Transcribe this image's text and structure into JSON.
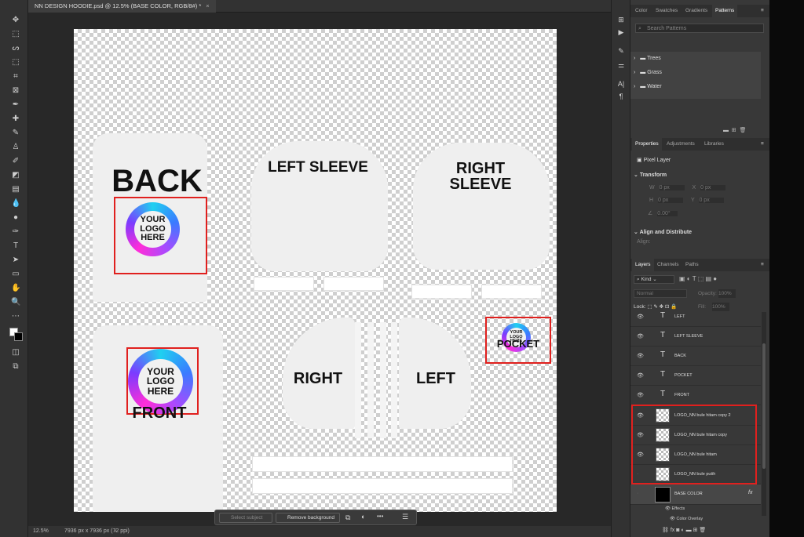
{
  "document": {
    "tab_title": "NN DESIGN HOODIE.psd @ 12.5% (BASE COLOR, RGB/8#) *",
    "tab_close": "×",
    "zoom": "12.5%",
    "dimensions": "7936 px x 7936 px (72 ppi)"
  },
  "artwork": {
    "back_label": "BACK",
    "left_sleeve": "LEFT SLEEVE",
    "right_sleeve": "RIGHT SLEEVE",
    "right_label": "RIGHT",
    "left_label": "LEFT",
    "pocket_label": "POCKET",
    "front_label": "FRONT",
    "logo_text": "YOUR LOGO HERE",
    "logo_text_small": "YOUR LOGO HERE"
  },
  "taskbar": {
    "select_subject": "Select subject",
    "remove_background": "Remove background",
    "more": "•••"
  },
  "patterns_panel": {
    "tabs": [
      "Color",
      "Swatches",
      "Gradients",
      "Patterns"
    ],
    "search_placeholder": "Search Patterns",
    "groups": [
      "Trees",
      "Grass",
      "Water"
    ]
  },
  "properties_panel": {
    "tabs": [
      "Properties",
      "Adjustments",
      "Libraries"
    ],
    "layer_type": "Pixel Layer",
    "transform_label": "Transform",
    "w_label": "W",
    "w_value": "0 px",
    "h_label": "H",
    "h_value": "0 px",
    "x_label": "X",
    "x_value": "0 px",
    "y_label": "Y",
    "y_value": "0 px",
    "angle_value": "0.00°",
    "align_label": "Align and Distribute",
    "align_sub": "Align:"
  },
  "layers_panel": {
    "tabs": [
      "Layers",
      "Channels",
      "Paths"
    ],
    "kind": "Kind",
    "blend_mode": "Normal",
    "opacity_label": "Opacity:",
    "opacity_value": "100%",
    "lock_label": "Lock:",
    "fill_label": "Fill:",
    "fill_value": "100%",
    "layers": [
      {
        "name": "LEFT",
        "type": "text"
      },
      {
        "name": "LEFT SLEEVE",
        "type": "text"
      },
      {
        "name": "BACK",
        "type": "text"
      },
      {
        "name": "POCKET",
        "type": "text"
      },
      {
        "name": "FRONT",
        "type": "text"
      },
      {
        "name": "LOGO_NN bule hitam copy 2",
        "type": "smart"
      },
      {
        "name": "LOGO_NN bule hitam copy",
        "type": "smart"
      },
      {
        "name": "LOGO_NN bule hitam",
        "type": "smart"
      },
      {
        "name": "LOGO_NN bule putih",
        "type": "smart"
      },
      {
        "name": "BASE COLOR",
        "type": "fill"
      }
    ],
    "effects_label": "Effects",
    "color_overlay_label": "Color Overlay",
    "fx": "fx"
  },
  "colors": {
    "highlight": "#e0201e",
    "panel_bg": "#383838",
    "canvas_bg": "#282828"
  }
}
